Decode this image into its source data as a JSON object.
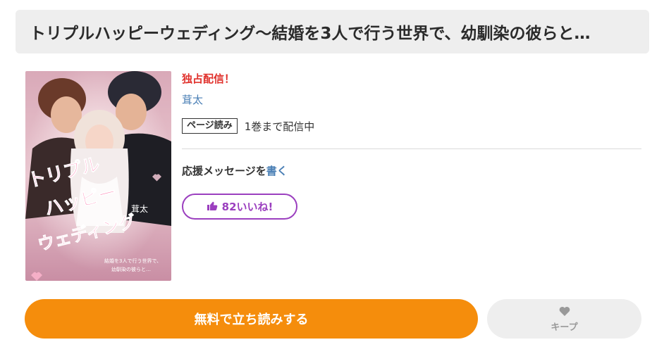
{
  "title": "トリプルハッピーウェディング～結婚を3人で行う世界で、幼馴染の彼らと…",
  "book": {
    "badge": "独占配信！",
    "author": "茸太",
    "format_tag": "ページ読み",
    "volume_status": "1巻まで配信中",
    "support_text": "応援メッセージを",
    "support_link": "書く",
    "likes_label": "82いいね!",
    "cover": {
      "title_line1": "トリプル",
      "title_line2": "ハッピー",
      "title_line3": "ウェディング",
      "author_mark": "茸太",
      "subtitle_line1": "結婚を3人で行う世界で、",
      "subtitle_line2": "幼馴染の彼らと…"
    }
  },
  "actions": {
    "read_label": "無料で立ち読みする",
    "keep_label": "キープ"
  },
  "colors": {
    "accent_orange": "#f58d0c",
    "like_purple": "#9b3fbf",
    "badge_red": "#e0312c",
    "link_blue": "#4a7fb5"
  }
}
